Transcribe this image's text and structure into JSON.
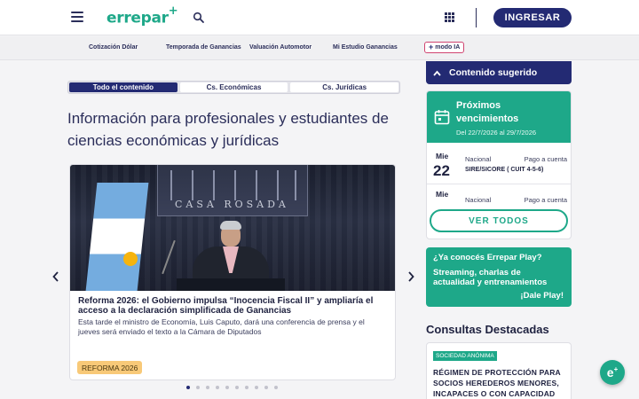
{
  "header": {
    "logo_text": "errepar",
    "logo_plus": "+",
    "login_label": "INGRESAR"
  },
  "subnav": {
    "items": [
      "Cotización Dólar",
      "Temporada de Ganancias",
      "Valuación Automotor",
      "Mi Estudio Ganancias"
    ],
    "modo_ia_plus": "+",
    "modo_ia": "modo IA"
  },
  "tabs": [
    "Todo el contenido",
    "Cs. Económicas",
    "Cs. Jurídicas"
  ],
  "main": {
    "headline": "Información para profesionales y estudiantes de ciencias económicas y jurídicas",
    "article": {
      "photo_caption": "CASA ROSADA",
      "title": "Reforma 2026: el Gobierno impulsa “Inocencia Fiscal II” y ampliaría el acceso a la declaración simplificada de Ganancias",
      "description": "Esta tarde el ministro de Economía, Luis Caputo, dará una conferencia de prensa y el jueves será enviado el texto a la Cámara de Diputados",
      "tag": "REFORMA 2026"
    }
  },
  "sidebar": {
    "suggested_title": "Contenido sugerido",
    "vencimientos": {
      "title": "Próximos vencimientos",
      "range": "Del 22/7/2026 al 29/7/2026",
      "events": [
        {
          "day": "Mie",
          "num": "22",
          "scope": "Nacional",
          "type": "Pago a cuenta",
          "name": "SIRE/SICORE ( CUIT 4-5-6)"
        },
        {
          "day": "Mie",
          "num": "",
          "scope": "Nacional",
          "type": "Pago a cuenta",
          "name": ""
        }
      ],
      "see_all": "VER TODOS"
    },
    "play": {
      "line1": "¿Ya conocés Errepar Play?",
      "line2": "Streaming, charlas de actualidad y entrenamientos",
      "line3": "¡Dale Play!"
    },
    "consultas": {
      "title": "Consultas Destacadas",
      "tag": "SOCIEDAD ANÓNIMA",
      "text": "RÉGIMEN DE PROTECCIÓN PARA SOCIOS HEREDEROS MENORES, INCAPACES O CON CAPACIDAD"
    }
  },
  "fab": {
    "text": "e",
    "sup": "+"
  },
  "colors": {
    "navy": "#232a73",
    "green": "#1ea889",
    "badge": "#f8c978"
  },
  "icons": [
    "menu-icon",
    "search-icon",
    "apps-grid-icon",
    "chevron-up-icon",
    "calendar-icon",
    "chevron-left-icon",
    "chevron-right-icon",
    "plus-icon"
  ]
}
